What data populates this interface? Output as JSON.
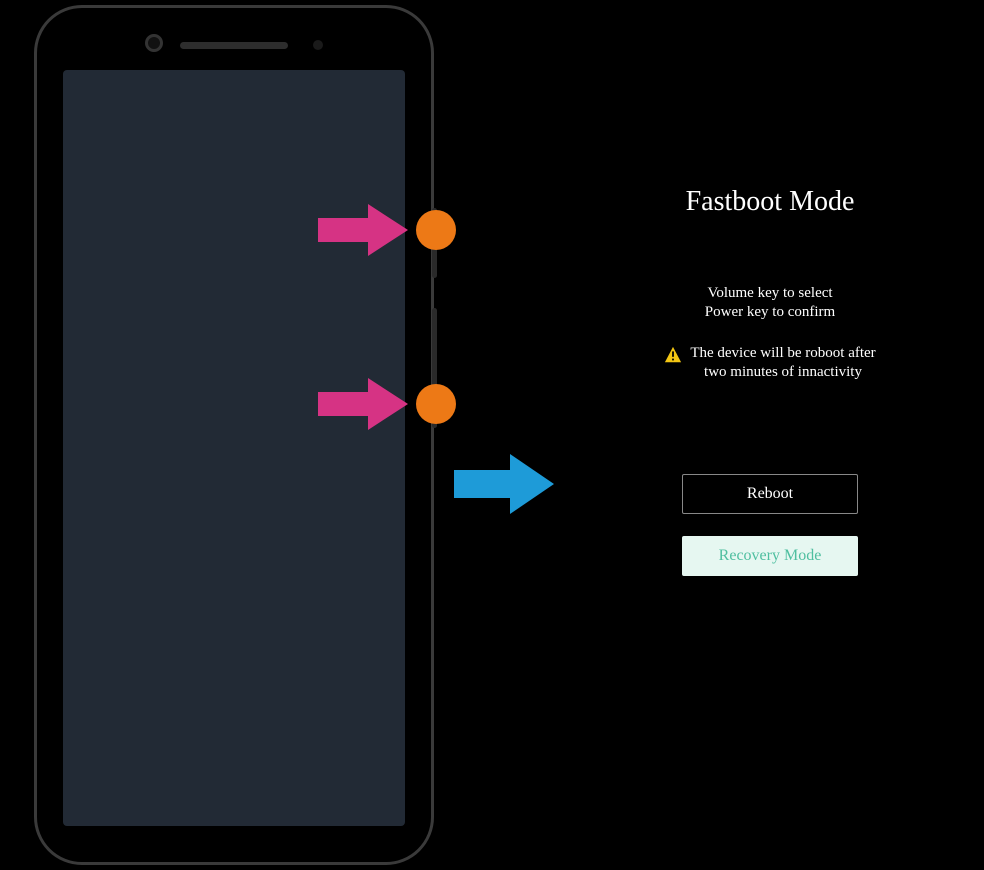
{
  "colors": {
    "pink_arrow": "#d63384",
    "blue_arrow": "#1e9bd8",
    "orange_dot": "#ed7916",
    "warning_triangle": "#f3c613",
    "selected_bg": "#e6f7f1",
    "selected_text": "#4fbfa0"
  },
  "fastboot": {
    "title": "Fastboot Mode",
    "instruction_line1": "Volume key to select",
    "instruction_line2": "Power key to confirm",
    "warning_line1": "The device will be roboot after",
    "warning_line2": "two minutes of innactivity",
    "reboot_label": "Reboot",
    "recovery_label": "Recovery Mode"
  }
}
